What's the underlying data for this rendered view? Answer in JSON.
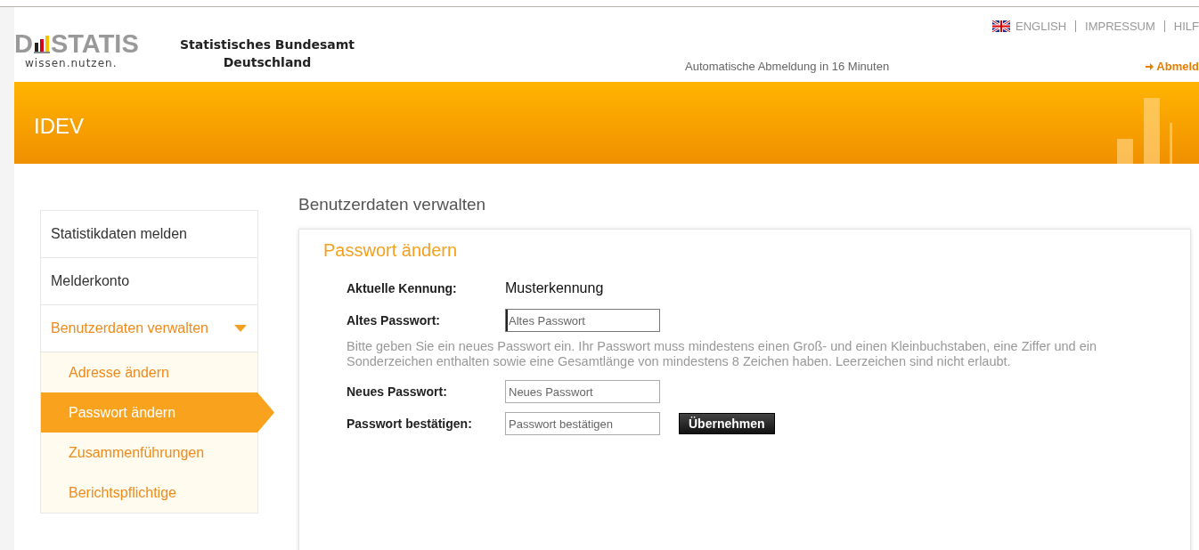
{
  "header": {
    "logo": {
      "word_start": "D",
      "word_end": "STATIS",
      "tagline": "wissen.nutzen."
    },
    "org_name": [
      "Statistisches Bundesamt",
      "Deutschland"
    ],
    "top_links": [
      {
        "label": "ENGLISH",
        "flag": true
      },
      {
        "label": "IMPRESSUM",
        "flag": false
      },
      {
        "label": "HILF",
        "flag": false
      }
    ],
    "session_notice": "Automatische Abmeldung in 16 Minuten",
    "logout": "Abmeld"
  },
  "banner": {
    "title": "IDEV"
  },
  "sidebar": {
    "items": [
      {
        "label": "Statistikdaten melden",
        "selected": false
      },
      {
        "label": "Melderkonto",
        "selected": false
      },
      {
        "label": "Benutzerdaten verwalten",
        "selected": true,
        "expanded": true,
        "children": [
          {
            "label": "Adresse ändern",
            "selected": false
          },
          {
            "label": "Passwort ändern",
            "selected": true
          },
          {
            "label": "Zusammenführungen",
            "selected": false
          },
          {
            "label": "Berichtspflichtige",
            "selected": false
          }
        ]
      }
    ]
  },
  "page_title": "Benutzerdaten verwalten",
  "form": {
    "title": "Passwort ändern",
    "fields": [
      {
        "kind": "text",
        "label": "Aktuelle Kennung:",
        "value": "Musterkennung"
      },
      {
        "kind": "input",
        "label": "Altes Passwort:",
        "placeholder": "Altes Passwort",
        "focused": true
      },
      {
        "kind": "hint",
        "text": "Bitte geben Sie ein neues Passwort ein. Ihr Passwort muss mindestens einen Groß- und einen Kleinbuchstaben, eine Ziffer und ein Sonderzeichen enthalten sowie eine Gesamtlänge von mindestens 8 Zeichen haben. Leerzeichen sind nicht erlaubt."
      },
      {
        "kind": "input",
        "label": "Neues Passwort:",
        "placeholder": "Neues Passwort",
        "focused": false
      },
      {
        "kind": "input",
        "label": "Passwort bestätigen:",
        "placeholder": "Passwort bestätigen",
        "focused": false,
        "button": "Übernehmen"
      }
    ]
  }
}
